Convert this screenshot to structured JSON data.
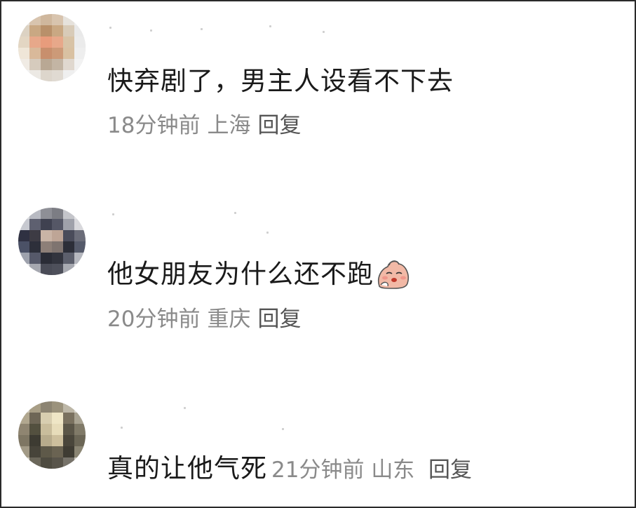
{
  "comments": [
    {
      "text": "快弃剧了，男主人设看不下去",
      "time": "18分钟前",
      "location": "上海",
      "reply_label": "回复",
      "avatar_colors": [
        "#e8e4de",
        "#d8c4ae",
        "#cfb79d",
        "#d8c4ae",
        "#e6e2dc",
        "#eeeeee",
        "#dcd2c3",
        "#c9a883",
        "#b8906a",
        "#c9a883",
        "#d8cbb8",
        "#e9e9e9",
        "#e3d6c3",
        "#e7a88a",
        "#e89c7c",
        "#e7a88a",
        "#d8c3a6",
        "#ebebeb",
        "#efe6d8",
        "#d9b99a",
        "#c88f6d",
        "#cc9a78",
        "#d9c1a2",
        "#eeeeee",
        "#f0ebe4",
        "#d6cbbd",
        "#b9a894",
        "#c3b5a4",
        "#e0d8cf",
        "#f2f2f2",
        "#f2f2f2",
        "#ece9e4",
        "#ddd6cc",
        "#e0dad2",
        "#efefef",
        "#f4f4f4"
      ]
    },
    {
      "text": "他女朋友为什么还不跑",
      "emoji": "sad-face-sticker",
      "time": "20分钟前",
      "location": "重庆",
      "reply_label": "回复",
      "avatar_colors": [
        "#dcdde0",
        "#b8bac2",
        "#8e8f96",
        "#7c7d84",
        "#c4c5ca",
        "#e3e3e6",
        "#c7c9d0",
        "#5e6070",
        "#3f4150",
        "#555766",
        "#9fa1aa",
        "#d8d8dc",
        "#2f3142",
        "#3d3b44",
        "#c9b4a6",
        "#bea596",
        "#4a4c5a",
        "#6b6d79",
        "#4b5166",
        "#2d2f3a",
        "#8d7f78",
        "#7f7470",
        "#2c2e38",
        "#555a6a",
        "#9ea2ad",
        "#56596a",
        "#2a2c36",
        "#32343e",
        "#5c5f6c",
        "#b6b8bf",
        "#e3e3e6",
        "#a6a8b0",
        "#4a4c57",
        "#4e505b",
        "#a8aab1",
        "#e6e6e8"
      ]
    },
    {
      "text": "真的让他气死",
      "time": "21分钟前",
      "location": "山东",
      "reply_label": "回复",
      "avatar_colors": [
        "#cfc9bb",
        "#a89e86",
        "#8c8472",
        "#9b927c",
        "#bdb7a7",
        "#d8d5cc",
        "#b1a78f",
        "#6e6656",
        "#d8ceb0",
        "#efe6c6",
        "#7a715f",
        "#a9a392",
        "#8f8571",
        "#53503f",
        "#c9bd9c",
        "#e7dcba",
        "#5b5648",
        "#807a68",
        "#7e7663",
        "#3d3b32",
        "#b7ab8c",
        "#cdbf9d",
        "#4a463b",
        "#6b6656",
        "#a29a86",
        "#47443a",
        "#5e5949",
        "#6a6352",
        "#3f3c33",
        "#8a8573",
        "#d0ccc1",
        "#6b675a",
        "#4e4b40",
        "#58544a",
        "#77736a",
        "#c9c6bd"
      ]
    }
  ]
}
